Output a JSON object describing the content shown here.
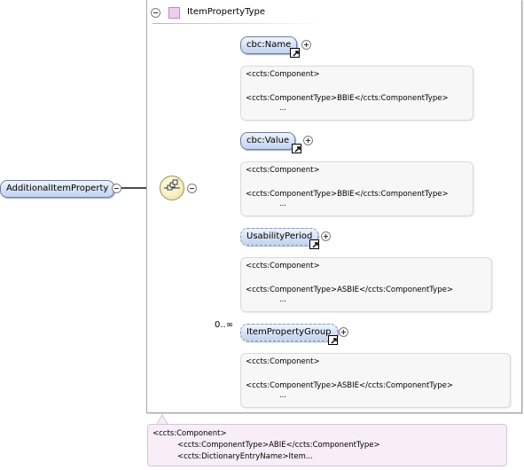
{
  "type": {
    "name": "ItemPropertyType"
  },
  "root": {
    "name": "AdditionalItemProperty"
  },
  "elements": [
    {
      "name": "cbc:Name",
      "annotation": [
        "<ccts:Component>",
        "<ccts:ComponentType>BBIE</ccts:ComponentType>",
        "..."
      ]
    },
    {
      "name": "cbc:Value",
      "annotation": [
        "<ccts:Component>",
        "<ccts:ComponentType>BBIE</ccts:ComponentType>",
        "..."
      ]
    },
    {
      "name": "UsabilityPeriod",
      "annotation": [
        "<ccts:Component>",
        "<ccts:ComponentType>ASBIE</ccts:ComponentType>",
        "..."
      ]
    },
    {
      "name": "ItemPropertyGroup",
      "cardinality": "0..∞",
      "annotation": [
        "<ccts:Component>",
        "<ccts:ComponentType>ASBIE</ccts:ComponentType>",
        "..."
      ]
    }
  ],
  "type_annotation": [
    "<ccts:Component>",
    "<ccts:ComponentType>ABIE</ccts:ComponentType>",
    "<ccts:DictionaryEntryName>Item..."
  ],
  "colors": {
    "element_fill": "#d6e2f6",
    "type_icon": "#eecdf0",
    "annotation_bg": "#f7f7f7",
    "type_annotation_bg": "#f7eef7",
    "sequence_fill": "#f7efc1"
  },
  "icons": {
    "collapse": "minus-circle-icon",
    "expand": "plus-circle-icon",
    "reference": "reference-arrow-icon",
    "sequence": "sequence-compositor-icon",
    "type": "complex-type-icon"
  }
}
